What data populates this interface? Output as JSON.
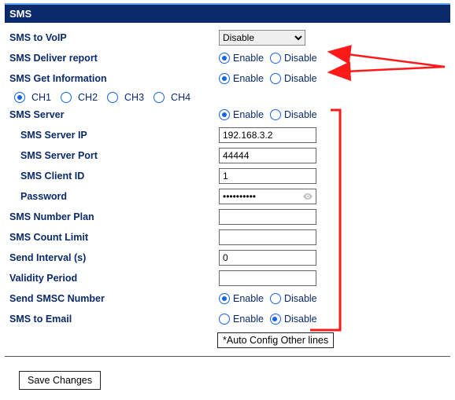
{
  "title": "SMS",
  "labels": {
    "sms_to_voip": "SMS to VoIP",
    "sms_deliver_report": "SMS Deliver report",
    "sms_get_information": "SMS Get Information",
    "sms_server": "SMS Server",
    "sms_server_ip": "SMS Server IP",
    "sms_server_port": "SMS Server Port",
    "sms_client_id": "SMS Client ID",
    "password": "Password",
    "sms_number_plan": "SMS Number Plan",
    "sms_count_limit": "SMS Count Limit",
    "send_interval": "Send Interval (s)",
    "validity_period": "Validity Period",
    "send_smsc_number": "Send SMSC Number",
    "sms_to_email": "SMS to Email"
  },
  "options": {
    "enable": "Enable",
    "disable": "Disable"
  },
  "channels": {
    "ch1": "CH1",
    "ch2": "CH2",
    "ch3": "CH3",
    "ch4": "CH4"
  },
  "values": {
    "sms_to_voip": "Disable",
    "sms_server_ip": "192.168.3.2",
    "sms_server_port": "44444",
    "sms_client_id": "1",
    "password": "••••••••••",
    "sms_number_plan": "",
    "sms_count_limit": "",
    "send_interval": "0",
    "validity_period": ""
  },
  "buttons": {
    "auto_config": "*Auto Config Other lines",
    "save": "Save Changes"
  }
}
